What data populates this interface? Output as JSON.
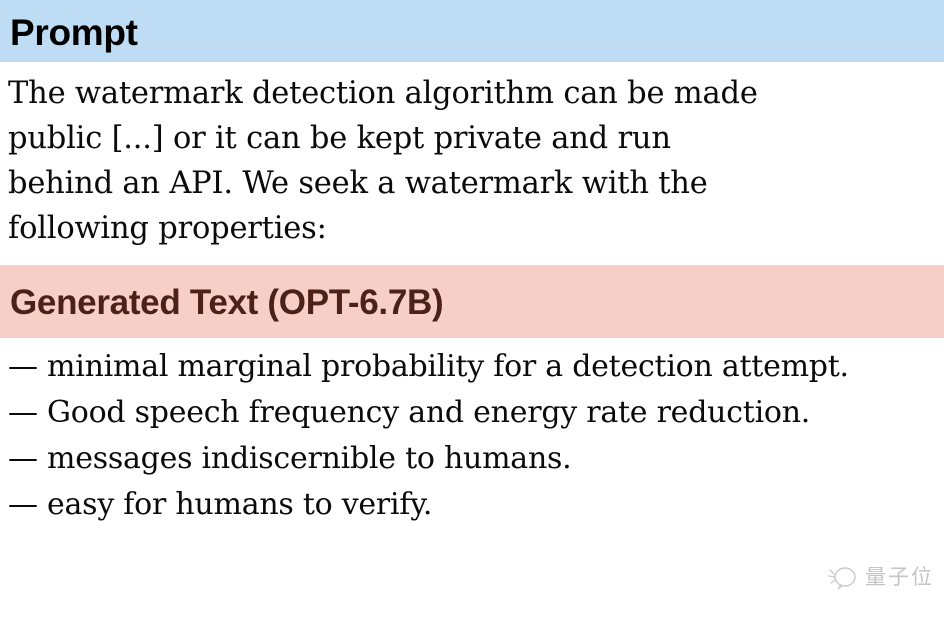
{
  "prompt_section": {
    "header_label": "Prompt",
    "header_bg": "#bfdcf5",
    "header_text_color": "#000000",
    "lines": [
      "The watermark detection algorithm can be made",
      "public [...] or it can be kept private and run",
      "behind an API. We seek a watermark with the",
      "following properties:"
    ],
    "full_text": "The watermark detection algorithm can be made public [...] or it can be kept private and run behind an API. We seek a watermark with the following properties:"
  },
  "generated_section": {
    "header_label": "Generated Text (OPT-6.7B)",
    "header_bg": "#f6cfc9",
    "header_text_color": "#4b2119",
    "lines": [
      "— minimal marginal probability for a detection attempt.",
      "— Good speech frequency and energy rate reduction.",
      "— messages indiscernible to humans.",
      "— easy for humans to verify."
    ]
  },
  "watermark": {
    "text": "量子位",
    "icon": "qbitai-logo-icon",
    "color": "#555555"
  }
}
